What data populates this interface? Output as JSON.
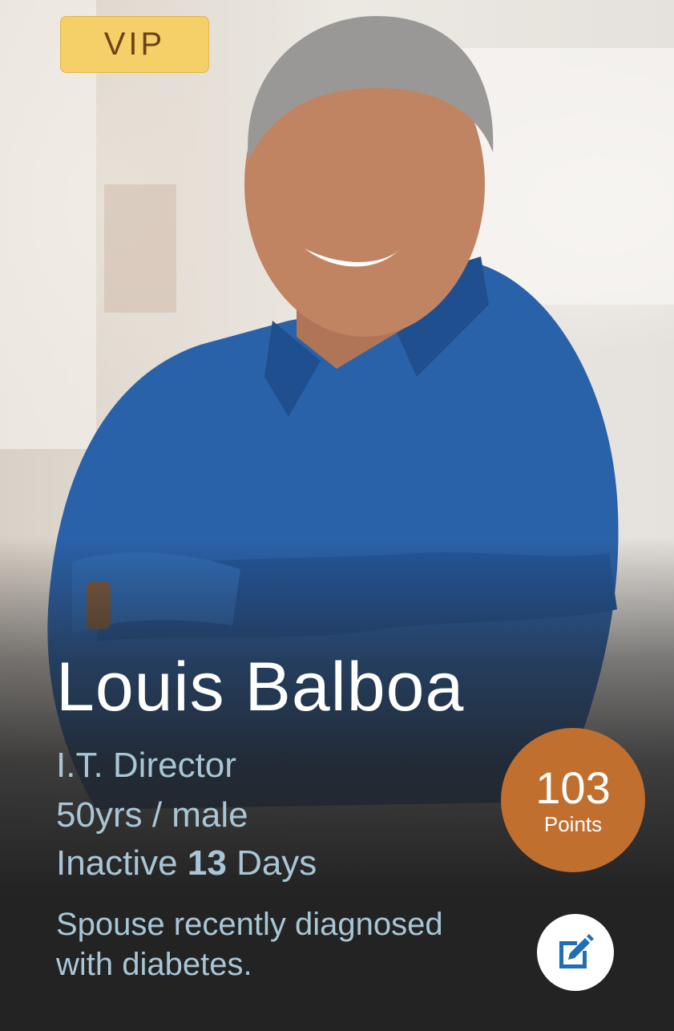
{
  "badge": "VIP",
  "profile": {
    "name": "Louis Balboa",
    "title": "I.T. Director",
    "age_gender": "50yrs / male",
    "inactive_prefix": "Inactive",
    "inactive_days": "13",
    "inactive_suffix": "Days"
  },
  "points": {
    "value": "103",
    "label": "Points"
  },
  "note": "Spouse recently diagnosed with diabetes.",
  "icons": {
    "edit": "edit-note-icon"
  },
  "colors": {
    "vip_badge": "#f5cf68",
    "points_circle": "#c06f2f",
    "accent_text": "#a9c6d6",
    "shirt": "#2a62aa",
    "edit_icon": "#1f6fb5"
  }
}
